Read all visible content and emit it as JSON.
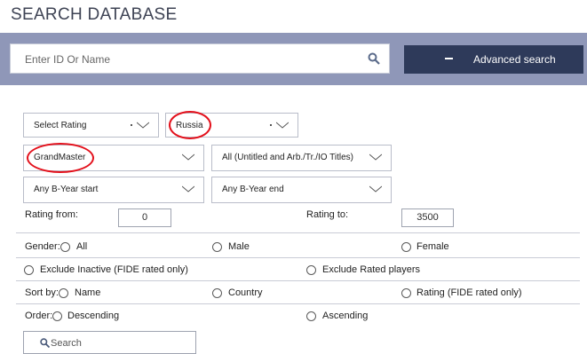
{
  "page": {
    "title": "SEARCH DATABASE"
  },
  "top_search": {
    "placeholder": "Enter ID Or Name",
    "search_icon": "magnifier-icon",
    "advanced_button": {
      "label": "Advanced search",
      "icon": "minus-icon"
    }
  },
  "filters": {
    "rating_select": "Select Rating",
    "country_select": "Russia",
    "title_select": "GrandMaster",
    "category_select": "All (Untitled and Arb./Tr./IO Titles)",
    "byear_start_select": "Any B-Year start",
    "byear_end_select": "Any B-Year end",
    "chevron_icon": "chevron-down-icon"
  },
  "rating_range": {
    "from_label": "Rating from:",
    "from_value": "0",
    "to_label": "Rating to:",
    "to_value": "3500"
  },
  "gender": {
    "label": "Gender:",
    "options": [
      "All",
      "Male",
      "Female"
    ]
  },
  "exclusions": {
    "options": [
      "Exclude Inactive (FIDE rated only)",
      "Exclude Rated players"
    ]
  },
  "sort": {
    "label": "Sort by:",
    "options": [
      "Name",
      "Country",
      "Rating (FIDE rated only)"
    ]
  },
  "order": {
    "label": "Order:",
    "options": [
      "Descending",
      "Ascending"
    ]
  },
  "submit": {
    "label": "Search",
    "icon": "magnifier-icon"
  },
  "annotation": {
    "color": "#e3101b"
  },
  "colors": {
    "band": "#8f97b8",
    "button": "#2e3a5a",
    "title": "#3e4354"
  }
}
